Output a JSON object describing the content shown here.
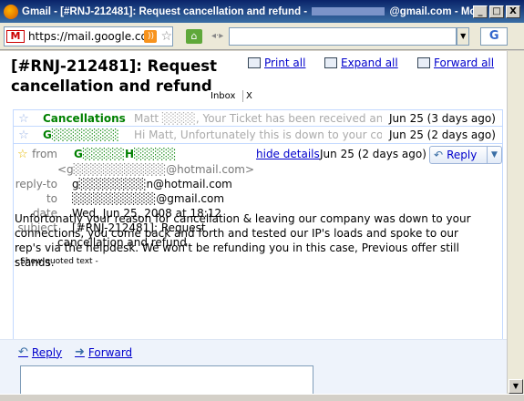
{
  "window": {
    "title_prefix": "Gmail - [#RNJ-212481]: Request cancellation and refund -",
    "title_suffix": "@gmail.com - Mozil...",
    "minimize": "_",
    "maximize": "□",
    "close": "X"
  },
  "nav": {
    "url": "https://mail.google.com/",
    "favicon": "M",
    "search_engine": "G"
  },
  "message": {
    "subject": "[#RNJ-212481]: Request cancellation and refund",
    "label_inbox": "Inbox",
    "label_remove": "X",
    "actions": {
      "print": "Print all",
      "expand": "Expand all",
      "forward": "Forward all"
    }
  },
  "thread": [
    {
      "sender": "Cancellations",
      "snippet": "Matt ░░░░, Your Ticket has been received and",
      "date": "Jun 25 (3 days ago)"
    },
    {
      "sender": "G░░░░░░░░",
      "snippet": "Hi Matt, Unfortunately this is down to your conn",
      "date": "Jun 25 (2 days ago)"
    }
  ],
  "open_message": {
    "from_label": "from",
    "from_name": "G░░░░░H░░░░░",
    "from_email": "<g░░░░░░░░░░░@hotmail.com>",
    "hide_details": "hide details",
    "date_short": "Jun 25 (2 days ago)",
    "reply": "Reply",
    "replyto_label": "reply-to",
    "replyto_value": "g░░░░░░░░n@hotmail.com",
    "to_label": "to",
    "to_value": "░░░░░░░░░░@gmail.com",
    "date_label": "date",
    "date_value": "Wed, Jun 25, 2008 at 18:12",
    "subject_label": "subject",
    "subject_value_1": "[#RNJ-212481]: Request",
    "subject_value_2": "cancellation and refund",
    "body": "Unfortonatly your reason for cancellation & leaving our company was down to your connections, you come back and forth and tested our IP's loads and spoke to our rep's via the helpdesk. We won't be refunding you in this case, Previous offer still stands.",
    "show_quoted": "- Show quoted text -"
  },
  "reply_bar": {
    "reply": "Reply",
    "forward": "Forward"
  }
}
